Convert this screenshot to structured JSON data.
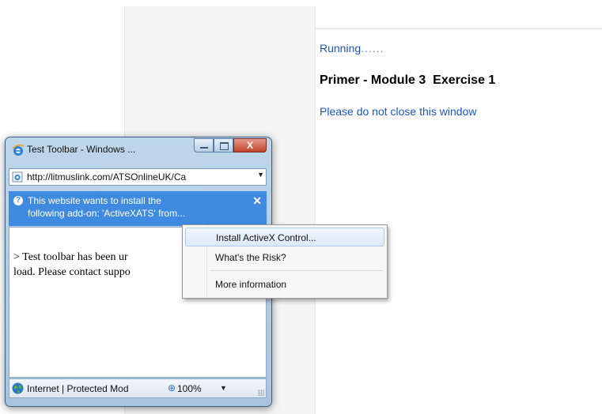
{
  "background_page": {
    "running_label": "Running",
    "running_dots": "......",
    "title": "Primer - Module 3  Exercise 1",
    "warning": "Please do not close this window"
  },
  "popup": {
    "title": "Test Toolbar - Windows ...",
    "address": "http://litmuslink.com/ATSOnlineUK/Ca",
    "infobar": {
      "line1": "This website wants to install the",
      "line2": "following add-on: 'ActiveXATS' from..."
    },
    "content": {
      "line1": "> Test toolbar has been ur",
      "line2": "load. Please contact suppo"
    },
    "status": {
      "zone": "Internet | Protected Mod",
      "zoom": "100%"
    },
    "window_controls": {
      "close_glyph": "X"
    }
  },
  "context_menu": {
    "items": [
      {
        "label": "Install ActiveX Control..."
      },
      {
        "label": "What's the Risk?"
      },
      {
        "label": "More information"
      }
    ]
  },
  "colors": {
    "link_blue": "#1a56c6",
    "infobar_blue": "#3e8ae0",
    "close_red": "#c2432c"
  },
  "icons": [
    "ie-icon",
    "page-icon",
    "info-icon",
    "close-icon",
    "globe-icon",
    "zoom-icon",
    "chevron-down-icon"
  ]
}
